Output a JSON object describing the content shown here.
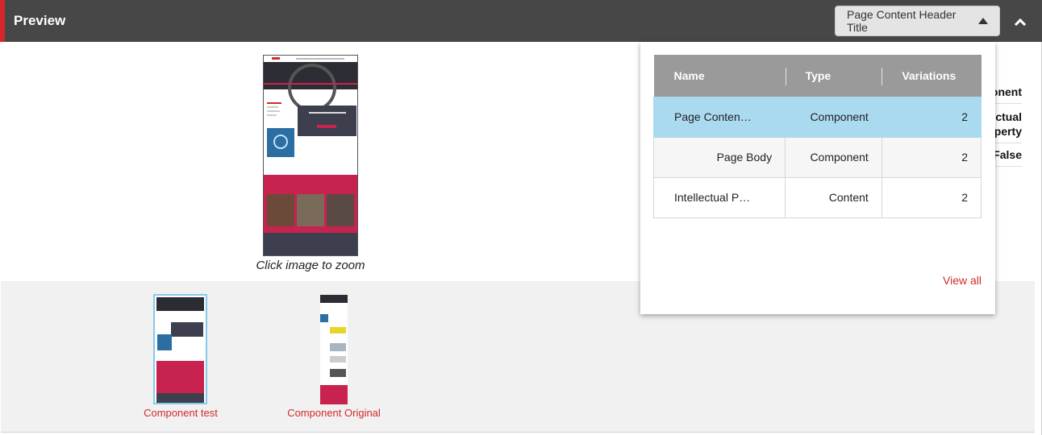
{
  "header": {
    "title": "Preview",
    "dropdown_label": "Page Content Header Title",
    "dropdown_icon": "triangle-up-icon",
    "collapse_icon": "chevron-up-icon",
    "accent_color": "#d6262c"
  },
  "preview": {
    "zoom_caption": "Click image to zoom"
  },
  "side_detail": {
    "lines": [
      "onent",
      "ectual",
      "perty",
      "False"
    ]
  },
  "variants": [
    {
      "label": "Component test"
    },
    {
      "label": "Component Original"
    }
  ],
  "popup": {
    "columns": [
      "Name",
      "Type",
      "Variations"
    ],
    "rows": [
      {
        "name": "Page Conten…",
        "type": "Component",
        "variations": "2"
      },
      {
        "name": "Page Body",
        "type": "Component",
        "variations": "2"
      },
      {
        "name": "Intellectual P…",
        "type": "Content",
        "variations": "2"
      }
    ],
    "view_all": "View all"
  },
  "colors": {
    "selected_row": "#aadaf0",
    "link": "#d12b2b"
  }
}
